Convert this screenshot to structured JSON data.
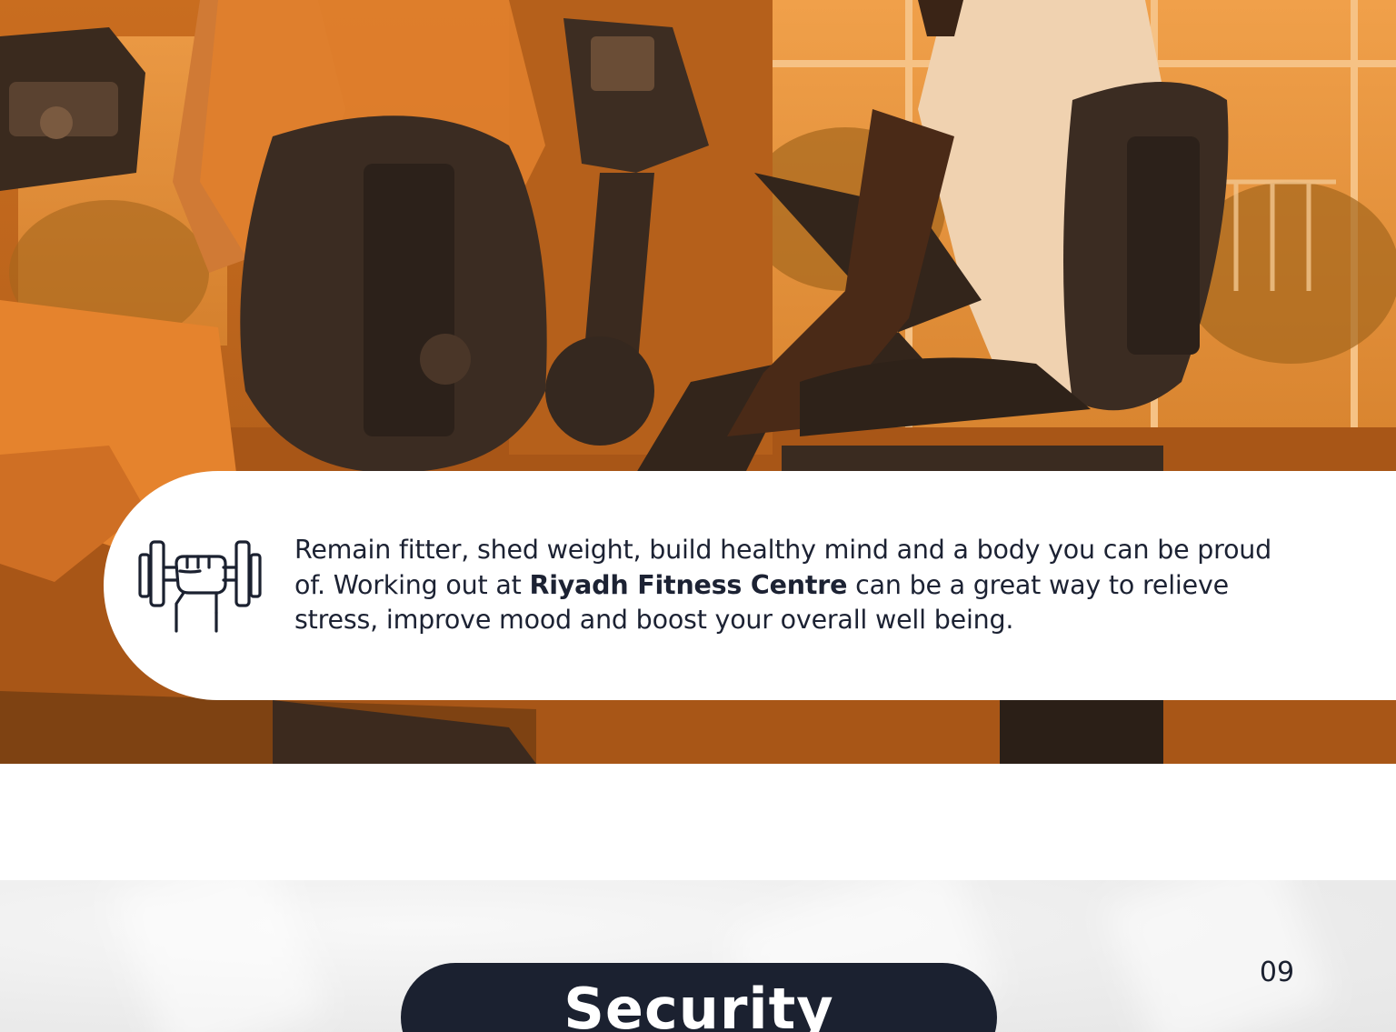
{
  "hero": {
    "photo": "gym-exercise-bike-photo",
    "tint_color": "#c8681c"
  },
  "info": {
    "icon": "dumbbell-fist-icon",
    "text_before": "Remain fitter, shed weight, build healthy mind and a body you can be proud of. Working out at ",
    "text_bold": "Riyadh Fitness Centre",
    "text_after": " can be a great way to relieve stress, improve mood and boost your overall well being."
  },
  "section": {
    "title": "Security",
    "page_number": "09"
  },
  "colors": {
    "dark": "#1b2130",
    "accent": "#c8681c",
    "background": "#ffffff"
  }
}
